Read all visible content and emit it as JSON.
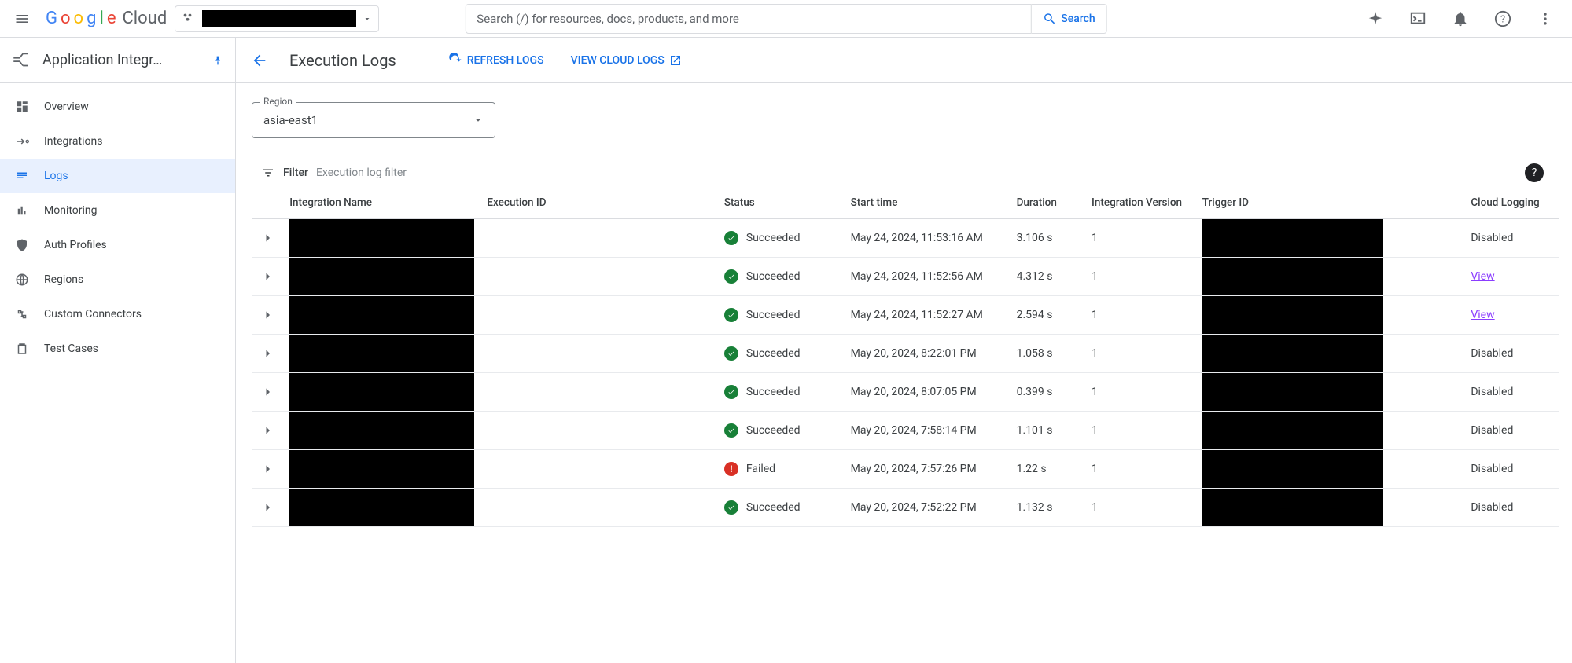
{
  "topbar": {
    "logo": "Google Cloud",
    "search_placeholder": "Search (/) for resources, docs, products, and more",
    "search_button": "Search"
  },
  "sidebar": {
    "title": "Application Integr…",
    "items": [
      {
        "icon": "overview-icon",
        "label": "Overview"
      },
      {
        "icon": "integrations-icon",
        "label": "Integrations"
      },
      {
        "icon": "logs-icon",
        "label": "Logs"
      },
      {
        "icon": "monitoring-icon",
        "label": "Monitoring"
      },
      {
        "icon": "auth-icon",
        "label": "Auth Profiles"
      },
      {
        "icon": "regions-icon",
        "label": "Regions"
      },
      {
        "icon": "connectors-icon",
        "label": "Custom Connectors"
      },
      {
        "icon": "testcases-icon",
        "label": "Test Cases"
      }
    ]
  },
  "header": {
    "page_title": "Execution Logs",
    "refresh": "REFRESH LOGS",
    "view_cloud": "VIEW CLOUD LOGS"
  },
  "region": {
    "label": "Region",
    "value": "asia-east1"
  },
  "filter": {
    "label": "Filter",
    "placeholder": "Execution log filter"
  },
  "table": {
    "headers": {
      "name": "Integration Name",
      "exec": "Execution ID",
      "status": "Status",
      "start": "Start time",
      "dur": "Duration",
      "ver": "Integration Version",
      "trig": "Trigger ID",
      "log": "Cloud Logging"
    },
    "rows": [
      {
        "status": "Succeeded",
        "status_ok": true,
        "start": "May 24, 2024, 11:53:16 AM",
        "dur": "3.106 s",
        "ver": "1",
        "log": "Disabled",
        "link": false
      },
      {
        "status": "Succeeded",
        "status_ok": true,
        "start": "May 24, 2024, 11:52:56 AM",
        "dur": "4.312 s",
        "ver": "1",
        "log": "View",
        "link": true
      },
      {
        "status": "Succeeded",
        "status_ok": true,
        "start": "May 24, 2024, 11:52:27 AM",
        "dur": "2.594 s",
        "ver": "1",
        "log": "View",
        "link": true
      },
      {
        "status": "Succeeded",
        "status_ok": true,
        "start": "May 20, 2024, 8:22:01 PM",
        "dur": "1.058 s",
        "ver": "1",
        "log": "Disabled",
        "link": false
      },
      {
        "status": "Succeeded",
        "status_ok": true,
        "start": "May 20, 2024, 8:07:05 PM",
        "dur": "0.399 s",
        "ver": "1",
        "log": "Disabled",
        "link": false
      },
      {
        "status": "Succeeded",
        "status_ok": true,
        "start": "May 20, 2024, 7:58:14 PM",
        "dur": "1.101 s",
        "ver": "1",
        "log": "Disabled",
        "link": false
      },
      {
        "status": "Failed",
        "status_ok": false,
        "start": "May 20, 2024, 7:57:26 PM",
        "dur": "1.22 s",
        "ver": "1",
        "log": "Disabled",
        "link": false
      },
      {
        "status": "Succeeded",
        "status_ok": true,
        "start": "May 20, 2024, 7:52:22 PM",
        "dur": "1.132 s",
        "ver": "1",
        "log": "Disabled",
        "link": false
      }
    ]
  }
}
